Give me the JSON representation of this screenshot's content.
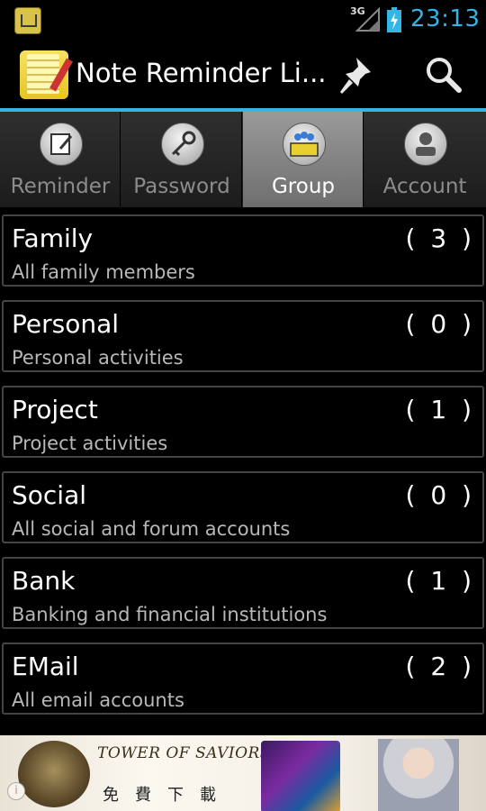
{
  "status_bar": {
    "network": "3G",
    "time": "23:13",
    "time_color": "#33b5e5"
  },
  "action_bar": {
    "title": "Note Reminder Li...",
    "accent_color": "#33b5e5",
    "icons": [
      "pin-icon",
      "search-icon"
    ]
  },
  "tabs": [
    {
      "label": "Reminder",
      "icon": "notepad-icon",
      "selected": false
    },
    {
      "label": "Password",
      "icon": "key-icon",
      "selected": false
    },
    {
      "label": "Group",
      "icon": "group-icon",
      "selected": true
    },
    {
      "label": "Account",
      "icon": "person-icon",
      "selected": false
    }
  ],
  "groups": [
    {
      "name": "Family",
      "count": "( 3 )",
      "description": "All family members"
    },
    {
      "name": "Personal",
      "count": "( 0 )",
      "description": "Personal activities"
    },
    {
      "name": "Project",
      "count": "( 1 )",
      "description": "Project activities"
    },
    {
      "name": "Social",
      "count": "( 0 )",
      "description": "All social and forum accounts"
    },
    {
      "name": "Bank",
      "count": "( 1 )",
      "description": "Banking and financial institutions"
    },
    {
      "name": "EMail",
      "count": "( 2 )",
      "description": "All email accounts"
    }
  ],
  "ad": {
    "title": "TOWER OF SAVIORS",
    "subtitle": "免費下載"
  }
}
